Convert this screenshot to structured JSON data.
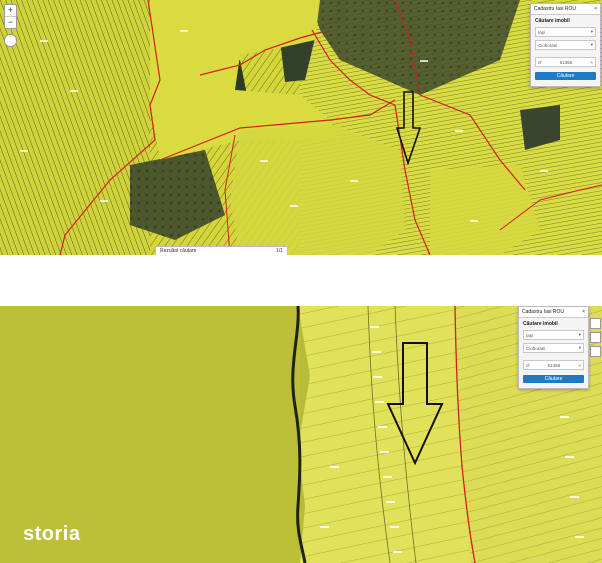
{
  "top_view": {
    "panel": {
      "title": "Cadastru Iasi  ROU",
      "section_title": "Căutare imobil",
      "county_value": "Iaşi",
      "locality_value": "Ciohorani",
      "search_type": "cf",
      "search_number": "61358",
      "search_button": "Căutare"
    },
    "results_label": "Rezultat căutare",
    "results_count": "1/1",
    "zoom_in": "+",
    "zoom_out": "−"
  },
  "bottom_view": {
    "panel": {
      "title": "Cadastru Iasi  ROU",
      "section_title": "Căutare imobil",
      "county_value": "Iaşi",
      "locality_value": "Ciohorani",
      "search_type": "cf",
      "search_number": "61358",
      "search_button": "Căutare"
    }
  },
  "logo_text": "storia",
  "colors": {
    "parcel_yellow": "#d8da3c",
    "boundary_red": "#d21f1f",
    "button_blue": "#1f7ac4"
  }
}
